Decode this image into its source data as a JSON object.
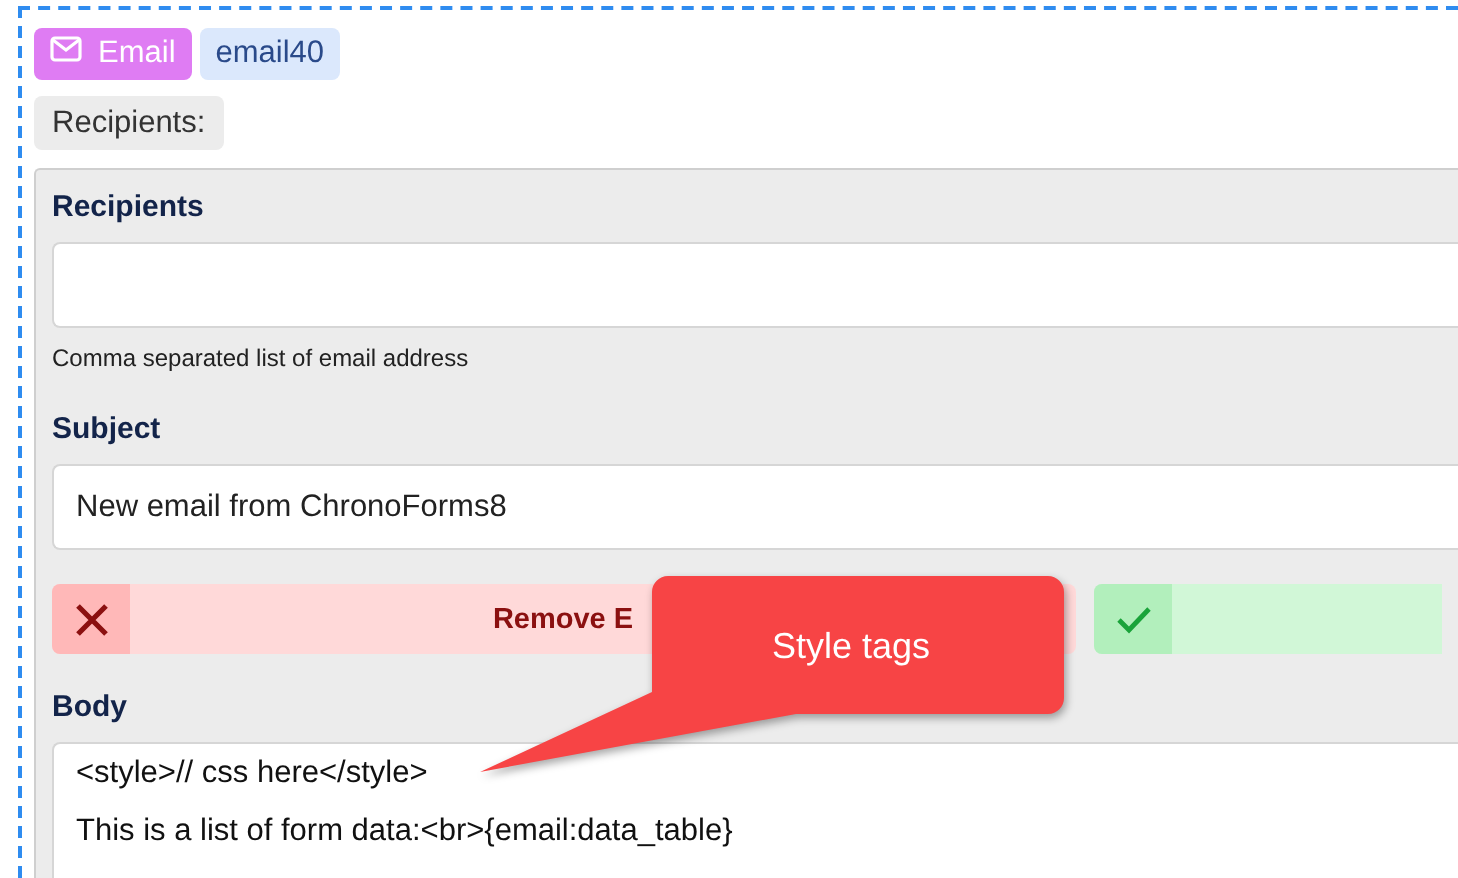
{
  "header": {
    "type_badge": {
      "kind": "email",
      "label": "Email"
    },
    "name_badge": "email40",
    "section_label": "Recipients:"
  },
  "items": [
    {
      "kind": "input",
      "label": "Recipients",
      "hint": "Comma separated list of email address"
    },
    {
      "kind": "input",
      "label": "Subject",
      "value": "New email from ChronoForms8"
    },
    {
      "kind": "buttons",
      "buttons": [
        {
          "kind": "remove",
          "label": "Remove E"
        },
        {
          "kind": "confirm"
        }
      ]
    },
    {
      "kind": "textarea",
      "label": "Body",
      "value": [
        "<style>// css here</style>",
        "This is a list of form data:<br>{email:data_table}"
      ]
    }
  ],
  "callout": {
    "text": "Style tags"
  }
}
